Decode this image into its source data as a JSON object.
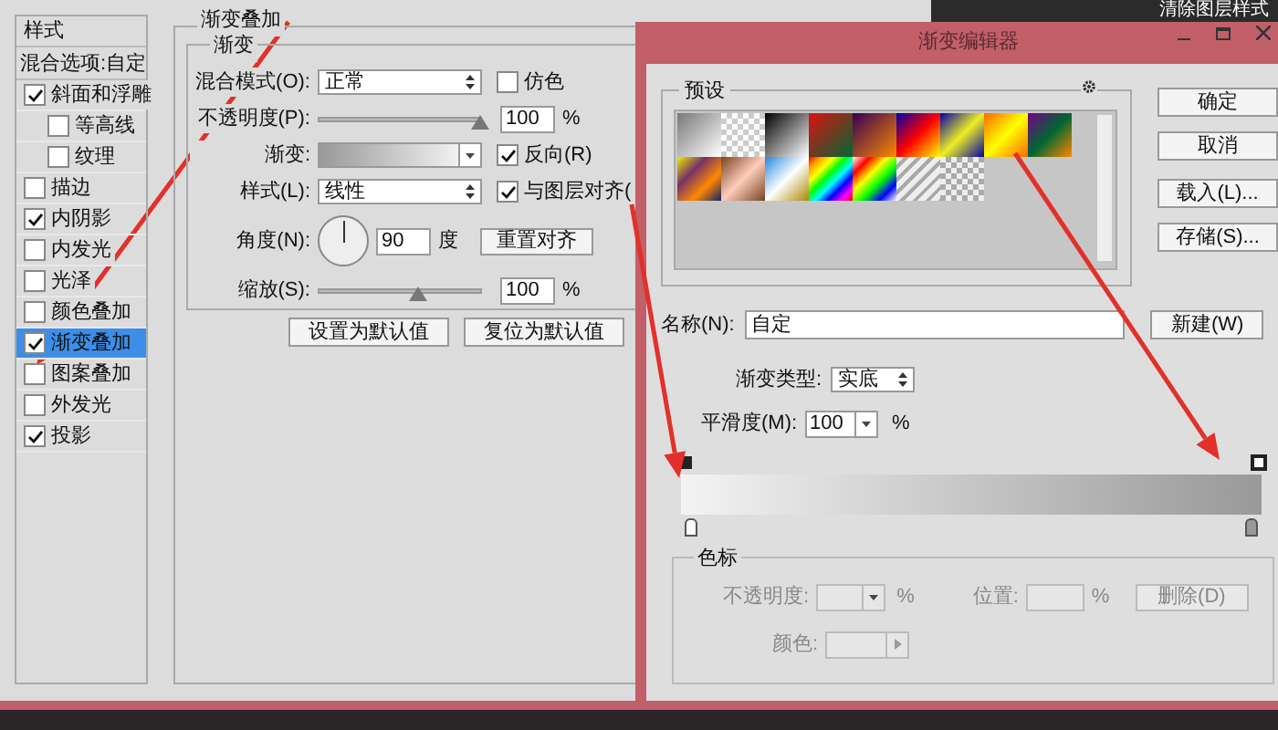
{
  "background": {
    "button": "清除图层样式"
  },
  "styles_panel": {
    "header": "样式",
    "blend_options": "混合选项:自定",
    "items": [
      {
        "label": "斜面和浮雕",
        "checked": true,
        "selected": false,
        "children": [
          {
            "label": "等高线",
            "checked": false,
            "selected": false
          },
          {
            "label": "纹理",
            "checked": false,
            "selected": false
          }
        ]
      },
      {
        "label": "描边",
        "checked": false,
        "selected": false
      },
      {
        "label": "内阴影",
        "checked": true,
        "selected": false
      },
      {
        "label": "内发光",
        "checked": false,
        "selected": false
      },
      {
        "label": "光泽",
        "checked": false,
        "selected": false
      },
      {
        "label": "颜色叠加",
        "checked": false,
        "selected": false
      },
      {
        "label": "渐变叠加",
        "checked": true,
        "selected": true
      },
      {
        "label": "图案叠加",
        "checked": false,
        "selected": false
      },
      {
        "label": "外发光",
        "checked": false,
        "selected": false
      },
      {
        "label": "投影",
        "checked": true,
        "selected": false
      }
    ]
  },
  "gradient_overlay": {
    "title": "渐变叠加",
    "group": "渐变",
    "blend_mode": {
      "label": "混合模式(O):",
      "value": "正常"
    },
    "dither": {
      "label": "仿色",
      "checked": false
    },
    "opacity": {
      "label": "不透明度(P):",
      "level": 0.98,
      "value": "100",
      "unit": "%"
    },
    "gradient": {
      "label": "渐变:"
    },
    "reverse": {
      "label": "反向(R)",
      "checked": true
    },
    "style": {
      "label": "样式(L):",
      "value": "线性"
    },
    "align": {
      "label": "与图层对齐(",
      "checked": true
    },
    "angle": {
      "label": "角度(N):",
      "value": "90",
      "unit": "度"
    },
    "reset_align": "重置对齐",
    "scale": {
      "label": "缩放(S):",
      "level": 0.6,
      "value": "100",
      "unit": "%"
    },
    "buttons": [
      "设置为默认值",
      "复位为默认值"
    ]
  },
  "gradient_editor": {
    "title": "渐变编辑器",
    "presets_label": "预设",
    "buttons": [
      "确定",
      "取消",
      "载入(L)...",
      "存储(S)..."
    ],
    "name": {
      "label": "名称(N):",
      "value": "自定"
    },
    "new_button": "新建(W)",
    "gradient_type": {
      "label": "渐变类型:",
      "value": "实底"
    },
    "smoothness": {
      "label": "平滑度(M):",
      "value": "100",
      "unit": "%"
    },
    "stops": {
      "title": "色标",
      "disabled": true,
      "opacity": {
        "label": "不透明度:",
        "unit": "%"
      },
      "position": {
        "label": "位置:",
        "unit": "%"
      },
      "delete": "删除(D)",
      "color": {
        "label": "颜色:"
      }
    }
  }
}
